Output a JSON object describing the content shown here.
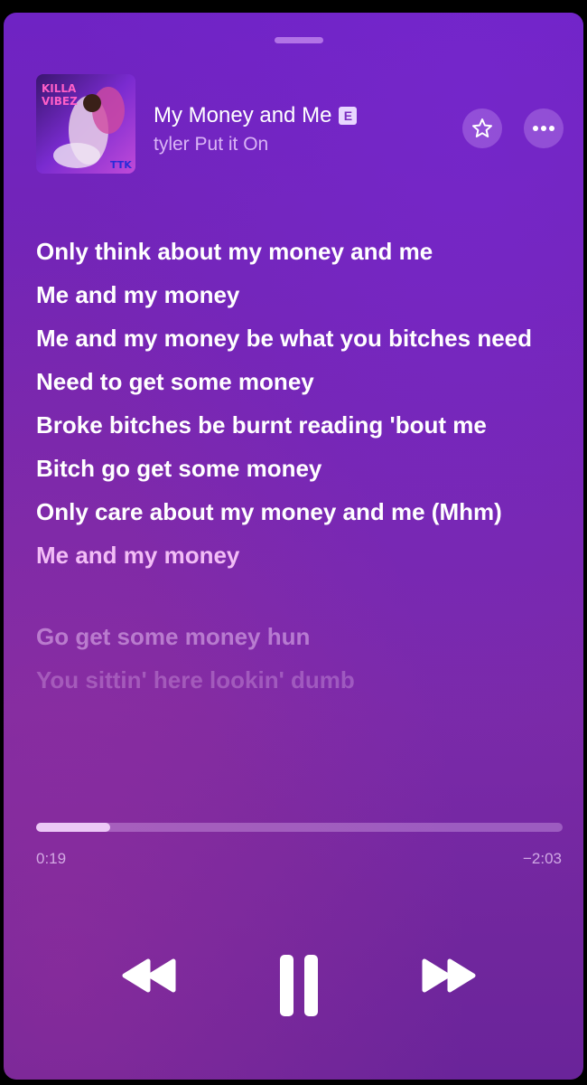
{
  "track": {
    "title": "My Money and Me",
    "explicit_badge": "E",
    "artist": "tyler Put it On",
    "artwork_text": [
      "KILLA",
      "VIBEZ",
      "TTK"
    ]
  },
  "lyrics": {
    "lines": [
      "Only think about my money and me",
      "Me and my money",
      "Me and my money be what you bitches need",
      "Need to get some money",
      "Broke bitches be burnt reading 'bout me",
      "Bitch go get some money",
      "Only care about my money and me (Mhm)",
      "Me and my money",
      "Go get some money hun",
      "You sittin' here lookin' dumb"
    ],
    "active_index": 7
  },
  "playback": {
    "elapsed": "0:19",
    "remaining": "−2:03",
    "progress": 0.14
  },
  "colors": {
    "background": "#7326b4",
    "active_lyric": "#f2bdf6"
  },
  "icons": {
    "favorite": "star-icon",
    "more": "ellipsis-icon",
    "previous": "rewind-icon",
    "play_pause": "pause-icon",
    "next": "fast-forward-icon"
  }
}
